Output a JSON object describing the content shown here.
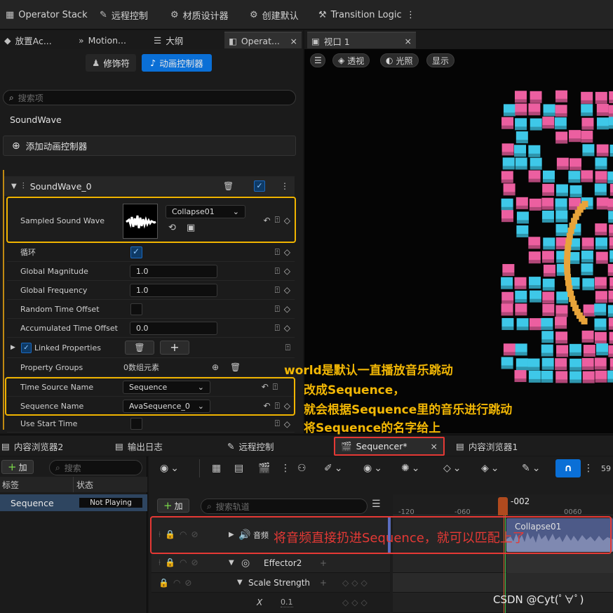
{
  "toolbar": {
    "items": [
      {
        "label": "Operator Stack",
        "icon": "stack-icon"
      },
      {
        "label": "远程控制",
        "icon": "remote-control-icon"
      },
      {
        "label": "材质设计器",
        "icon": "material-designer-icon"
      },
      {
        "label": "创建默认",
        "icon": "create-default-icon"
      },
      {
        "label": "Transition Logic",
        "icon": "transition-logic-icon"
      }
    ],
    "more": "⋮"
  },
  "left_tabs": [
    {
      "label": "放置Ac..."
    },
    {
      "label": "Motion..."
    },
    {
      "label": "大纲"
    },
    {
      "label": "Operat...",
      "close": "×"
    }
  ],
  "viewport_tab": {
    "label": "视口 1",
    "close": "×"
  },
  "details": {
    "mode_buttons": {
      "modifiers": "修饰符",
      "animators": "动画控制器"
    },
    "search_placeholder": "搜索项",
    "actor_name": "SoundWave",
    "add_animator": "添加动画控制器",
    "section_title": "SoundWave_0",
    "properties": {
      "sampled_sound_wave": {
        "label": "Sampled Sound Wave",
        "asset": "Collapse01"
      },
      "loop": {
        "label": "循环",
        "checked": true
      },
      "global_magnitude": {
        "label": "Global Magnitude",
        "value": "1.0"
      },
      "global_frequency": {
        "label": "Global Frequency",
        "value": "1.0"
      },
      "random_time_offset": {
        "label": "Random Time Offset",
        "checked": false
      },
      "accumulated_time_offset": {
        "label": "Accumulated Time Offset",
        "value": "0.0"
      },
      "linked_properties": {
        "label": "Linked Properties",
        "checked": true
      },
      "property_groups": {
        "label": "Property Groups",
        "value": "0数组元素"
      },
      "time_source_name": {
        "label": "Time Source Name",
        "value": "Sequence"
      },
      "sequence_name": {
        "label": "Sequence Name",
        "value": "AvaSequence_0"
      },
      "use_start_time": {
        "label": "Use Start Time",
        "checked": false
      }
    }
  },
  "viewport": {
    "buttons": {
      "perspective": "透视",
      "lighting": "光照",
      "show": "显示"
    },
    "annotation": [
      "world是默认一直播放音乐跳动",
      "改成Sequence，",
      "就会根据Sequence里的音乐进行跳动",
      "将Sequence的名字给上"
    ]
  },
  "bottom_tabs": [
    {
      "label": "内容浏览器2"
    },
    {
      "label": "输出日志"
    },
    {
      "label": "远程控制"
    },
    {
      "label": "Sequencer*",
      "close": "×"
    },
    {
      "label": "内容浏览器1"
    }
  ],
  "sequence_list": {
    "add_label": "加",
    "search_placeholder": "搜索",
    "columns": [
      "标签",
      "状态"
    ],
    "rows": [
      {
        "name": "Sequence",
        "status": "Not Playing"
      }
    ]
  },
  "sequencer": {
    "add_track": "加",
    "search_placeholder": "搜索轨道",
    "frame_readout": "59",
    "playhead": "-002",
    "ruler": [
      "-120",
      "-060",
      "0060"
    ],
    "tracks": [
      {
        "label": "音频",
        "clip": "Collapse01"
      },
      {
        "label": "Effector2"
      },
      {
        "label": "Scale Strength"
      },
      {
        "label": "X",
        "value": "0.1"
      }
    ],
    "annotation": "将音频直接扔进Sequence，就可以匹配上了"
  },
  "watermark": "CSDN @Cyt(ﾟ∀ﾟ)",
  "colors": {
    "accent": "#0a6fd6",
    "highlight_yellow": "#f0b400",
    "highlight_red": "#e53935",
    "cube_pink": "#ec5fa0",
    "cube_cyan": "#3ec8e8",
    "cube_orange": "#e8a43a"
  }
}
